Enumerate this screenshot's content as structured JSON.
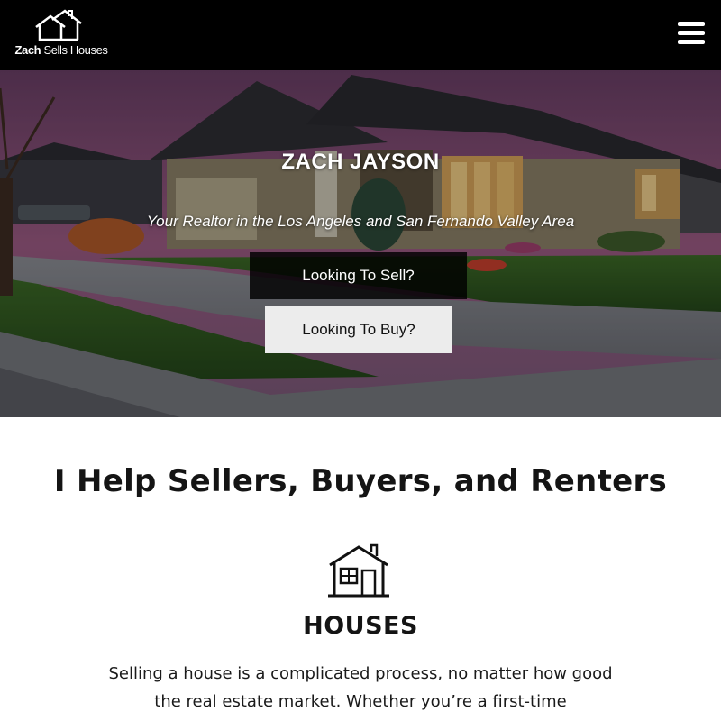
{
  "header": {
    "logo_bold": "Zach",
    "logo_rest": " Sells Houses",
    "menu_icon": "hamburger-menu-icon"
  },
  "hero": {
    "title": "ZACH JAYSON",
    "subtitle": "Your Realtor in the Los Angeles and San Fernando Valley Area",
    "sell_button": "Looking To Sell?",
    "buy_button": "Looking To Buy?"
  },
  "main": {
    "section_title": "I Help Sellers, Buyers, and Renters",
    "service": {
      "icon": "house-icon",
      "title": "HOUSES",
      "text": "Selling a house is a complicated process, no matter how good the real estate market. Whether you’re a first-time"
    }
  },
  "colors": {
    "header_bg": "#000000",
    "sell_button_bg": "#111111",
    "buy_button_bg": "#ececec",
    "text": "#141414"
  }
}
